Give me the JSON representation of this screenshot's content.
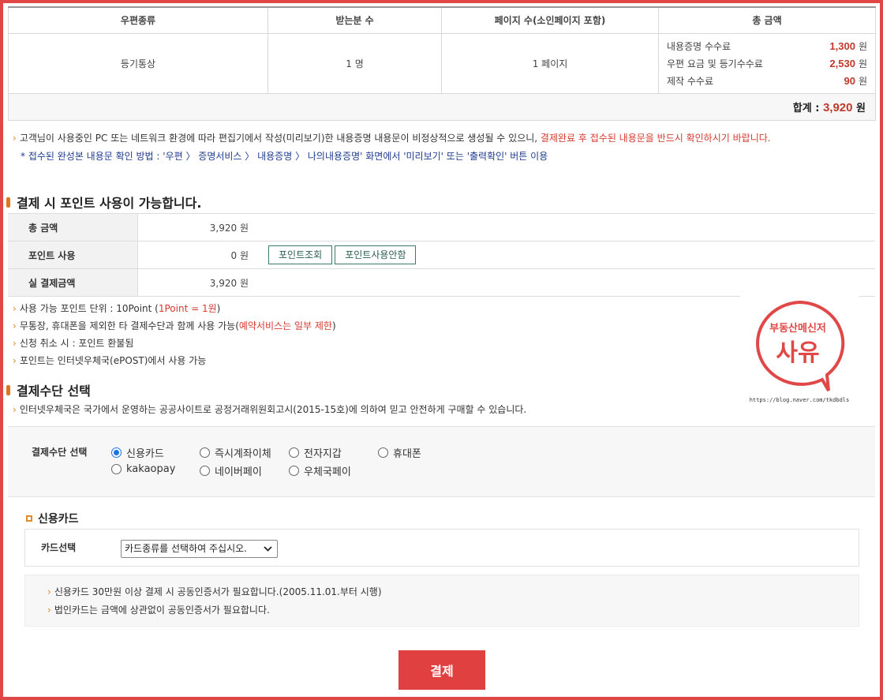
{
  "summary": {
    "headers": [
      "우편종류",
      "받는분 수",
      "페이지 수(소인페이지 포함)",
      "총 금액"
    ],
    "mail_type": "등기통상",
    "recipients": "1 명",
    "pages": "1 페이지",
    "fees": [
      {
        "label": "내용증명 수수료",
        "amount": "1,300",
        "unit": "원"
      },
      {
        "label": "우편 요금 및 등기수수료",
        "amount": "2,530",
        "unit": "원"
      },
      {
        "label": "제작 수수료",
        "amount": "90",
        "unit": "원"
      }
    ],
    "total_label": "합계 :",
    "total_amount": "3,920",
    "total_unit": "원"
  },
  "notice": {
    "line1_a": "고객님이 사용중인 PC 또는 네트워크 환경에 따라 편집기에서 작성(미리보기)한 내용증명 내용문이 비정상적으로 생성될 수 있으니,",
    "line1_b": "결제완료 후 접수된 내용문을 반드시 확인하시기 바랍니다.",
    "line2": "* 접수된 완성본 내용문 확인 방법 : '우편 〉 증명서비스 〉 내용증명 〉 나의내용증명' 화면에서 '미리보기' 또는 '출력확인' 버튼 이용"
  },
  "points": {
    "title": "결제 시 포인트 사용이 가능합니다.",
    "rows": [
      {
        "label": "총 금액",
        "value": "3,920 원"
      },
      {
        "label": "포인트 사용",
        "value": "0 원"
      },
      {
        "label": "실 결제금액",
        "value": "3,920 원"
      }
    ],
    "btn_lookup": "포인트조회",
    "btn_nouse": "포인트사용안함",
    "notes": {
      "n1_a": "사용 가능 포인트 단위 : 10Point (",
      "n1_b": "1Point = 1원",
      "n1_c": ")",
      "n2_a": "무통장, 휴대폰을 제외한 타 결제수단과 함께 사용 가능(",
      "n2_b": "예약서비스는 일부 제한",
      "n2_c": ")",
      "n3": "신청 취소 시 : 포인트 환불됨",
      "n4": "포인트는 인터넷우체국(ePOST)에서 사용 가능"
    }
  },
  "payment": {
    "title": "결제수단 선택",
    "desc": "인터넷우체국은 국가에서 운영하는 공공사이트로 공정거래위원회고시(2015-15호)에 의하여 믿고 안전하게 구매할 수 있습니다.",
    "label": "결제수단 선택",
    "options": [
      "신용카드",
      "즉시계좌이체",
      "전자지갑",
      "휴대폰",
      "kakaopay",
      "네이버페이",
      "우체국페이"
    ],
    "selected": "신용카드"
  },
  "card": {
    "title": "신용카드",
    "select_label": "카드선택",
    "select_value": "카드종류를 선택하여 주십시오.",
    "info1": "신용카드 30만원 이상 결제 시 공동인증서가 필요합니다.(2005.11.01.부터 시행)",
    "info2": "법인카드는 금액에 상관없이 공동인증서가 필요합니다."
  },
  "pay_button": "결제",
  "watermark": {
    "line1": "부동산메신저",
    "line2": "사유",
    "url": "https://blog.naver.com/tkdbdls"
  },
  "colors": {
    "accent_red": "#e04040",
    "amount_red": "#c0392b",
    "bullet_orange": "#e08a2a",
    "link_blue": "#1f3c8e"
  }
}
